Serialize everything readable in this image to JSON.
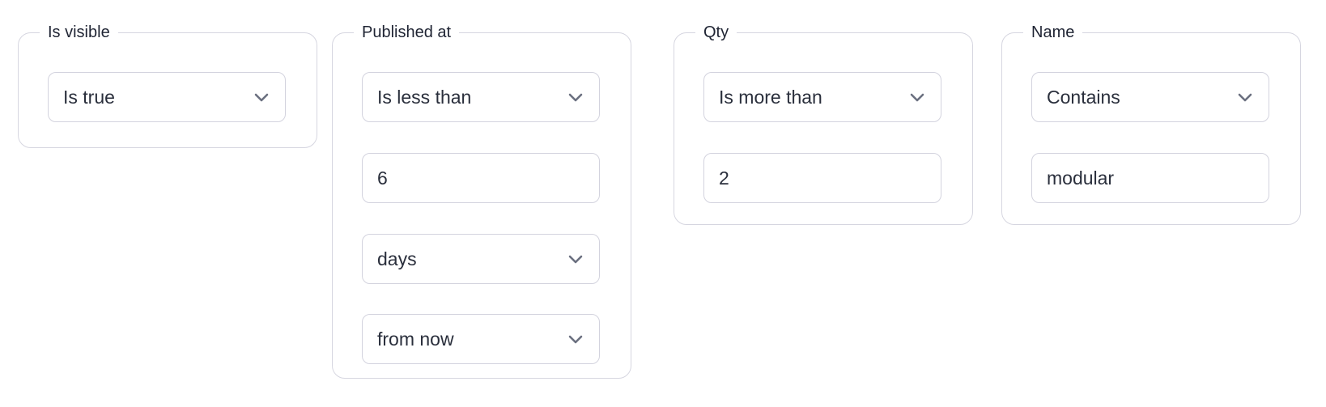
{
  "filters": [
    {
      "label": "Is visible",
      "operator": "Is true"
    },
    {
      "label": "Published at",
      "operator": "Is less than",
      "value": "6",
      "unit": "days",
      "direction": "from now"
    },
    {
      "label": "Qty",
      "operator": "Is more than",
      "value": "2"
    },
    {
      "label": "Name",
      "operator": "Contains",
      "value": "modular"
    }
  ],
  "icons": {
    "dropdown": "chevron-down-icon"
  },
  "colors": {
    "border": "#d6d6e0",
    "text": "#1f2433",
    "chevron": "#6b7080"
  }
}
